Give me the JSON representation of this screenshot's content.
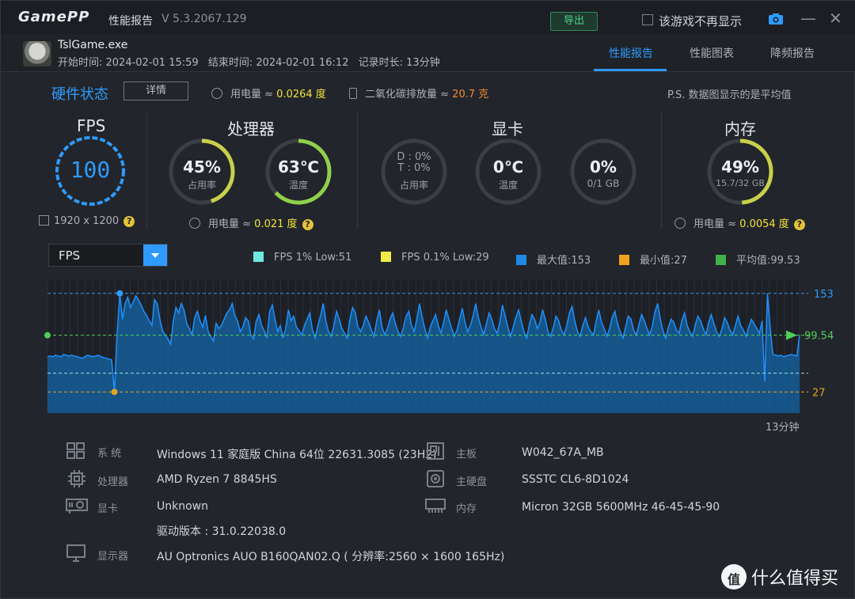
{
  "app": {
    "logo": "GamePP",
    "title": "性能报告",
    "version": "V 5.3.2067.129",
    "export_label": "导出",
    "dont_show_label": "该游戏不再显示"
  },
  "header": {
    "exe": "TslGame.exe",
    "start": "开始时间: 2024-02-01 15:59",
    "end": "结束时间: 2024-02-01 16:12",
    "duration": "记录时长: 13分钟",
    "tabs": [
      {
        "label": "性能报告",
        "active": true
      },
      {
        "label": "性能图表",
        "active": false
      },
      {
        "label": "降频报告",
        "active": false
      }
    ]
  },
  "hardware": {
    "title": "硬件状态",
    "detail_label": "详情",
    "power_prefix": "用电量 ≈ ",
    "power_value": "0.0264 度",
    "co2_prefix": "二氧化碳排放量 ≈ ",
    "co2_value": "20.7 克",
    "ps_note": "P.S. 数据图显示的是平均值"
  },
  "fps_panel": {
    "title": "FPS",
    "value": "100",
    "resolution": "1920 x 1200"
  },
  "cpu_panel": {
    "title": "处理器",
    "usage": {
      "value": "45%",
      "label": "占用率",
      "fraction": 0.45
    },
    "temp": {
      "value": "63℃",
      "label": "温度",
      "fraction": 0.63
    },
    "power_prefix": "用电量 ≈ ",
    "power_value": "0.021 度"
  },
  "gpu_panel": {
    "title": "显卡",
    "usage": {
      "line1": "D : 0%",
      "line2": "T : 0%",
      "label": "占用率",
      "fraction": 0
    },
    "temp": {
      "value": "0℃",
      "label": "温度",
      "fraction": 0
    },
    "vram": {
      "value": "0%",
      "label": "0/1 GB",
      "fraction": 0
    }
  },
  "mem_panel": {
    "title": "内存",
    "usage": {
      "value": "49%",
      "label": "15.7/32 GB",
      "fraction": 0.49
    },
    "power_prefix": "用电量 ≈ ",
    "power_value": "0.0054 度"
  },
  "chart_controls": {
    "selected_metric": "FPS",
    "legend": [
      {
        "label": "FPS 1% Low:51",
        "color": "#6ee7e0"
      },
      {
        "label": "FPS 0.1% Low:29",
        "color": "#f2ea4a"
      },
      {
        "label": "最大值:153",
        "color": "#1e88e5"
      },
      {
        "label": "最小值:27",
        "color": "#f0a21e"
      },
      {
        "label": "平均值:99.53",
        "color": "#3fb24a"
      }
    ],
    "duration_label": "13分钟"
  },
  "chart_data": {
    "type": "area",
    "title": "",
    "xlabel": "",
    "ylabel": "",
    "duration_minutes": 13,
    "y_markers": {
      "max": 153,
      "avg": 99.54,
      "min": 27
    },
    "max_label": "153",
    "avg_label": "99.54",
    "min_label": "27",
    "ylim": [
      0,
      170
    ],
    "series": [
      {
        "values": [
          72,
          73,
          72,
          74,
          73,
          72,
          75,
          74,
          73,
          74,
          73,
          72,
          71,
          70,
          72,
          74,
          73,
          72,
          73,
          74,
          72,
          71,
          70,
          69,
          68,
          27,
          100,
          153,
          120,
          140,
          148,
          135,
          142,
          150,
          145,
          138,
          130,
          125,
          118,
          112,
          145,
          140,
          120,
          105,
          100,
          95,
          88,
          118,
          135,
          128,
          140,
          132,
          115,
          108,
          100,
          122,
          130,
          118,
          110,
          125,
          105,
          98,
          92,
          115,
          108,
          112,
          120,
          128,
          132,
          140,
          125,
          118,
          104,
          110,
          122,
          118,
          100,
          95,
          118,
          126,
          112,
          105,
          96,
          130,
          138,
          120,
          104,
          112,
          96,
          108,
          132,
          118,
          124,
          110,
          105,
          100,
          112,
          120,
          128,
          106,
          96,
          112,
          124,
          140,
          118,
          104,
          98,
          112,
          130,
          120,
          108,
          102,
          96,
          120,
          135,
          128,
          110,
          104,
          112,
          124,
          116,
          106,
          98,
          118,
          132,
          110,
          100,
          108,
          120,
          128,
          114,
          104,
          98,
          110,
          124,
          130,
          112,
          104,
          120,
          140,
          122,
          108,
          96,
          110,
          118,
          126,
          112,
          102,
          116,
          132,
          120,
          108,
          98,
          106,
          120,
          134,
          116,
          104,
          112,
          124,
          140,
          122,
          110,
          100,
          114,
          128,
          120,
          108,
          102,
          116,
          138,
          124,
          110,
          98,
          110,
          122,
          132,
          118,
          104,
          96,
          112,
          126,
          120,
          108,
          116,
          132,
          120,
          104,
          98,
          110,
          124,
          118,
          106,
          100,
          112,
          128,
          136,
          118,
          104,
          98,
          112,
          122,
          110,
          104,
          100,
          118,
          132,
          116,
          108,
          98,
          108,
          122,
          130,
          114,
          104,
          96,
          110,
          124,
          120,
          106,
          100,
          114,
          126,
          118,
          108,
          100,
          112,
          130,
          140,
          120,
          104,
          96,
          110,
          120,
          116,
          106,
          102,
          118,
          128,
          112,
          104,
          98,
          112,
          124,
          118,
          108,
          100,
          116,
          126,
          114,
          104,
          98,
          108,
          122,
          116,
          106,
          100,
          112,
          124,
          112,
          106,
          98,
          110,
          120,
          114,
          108,
          102,
          118,
          40,
          153,
          110,
          75,
          74,
          73,
          74,
          72,
          73,
          74,
          75,
          74,
          73,
          100
        ]
      }
    ]
  },
  "system_info": [
    {
      "key": "系  统",
      "value": "Windows 11 家庭版 China 64位 22631.3085 (23H2)",
      "icon": "windows-icon"
    },
    {
      "key": "处理器",
      "value": "AMD Ryzen 7 8845HS",
      "icon": "cpu-icon"
    },
    {
      "key": "显卡",
      "value": "Unknown",
      "icon": "gpu-icon"
    },
    {
      "key": "",
      "value": "驱动版本 : 31.0.22038.0",
      "icon": ""
    },
    {
      "key": "显示器",
      "value": "AU Optronics AUO B160QAN02.Q ( 分辨率:2560 × 1600 165Hz)",
      "icon": "monitor-icon"
    },
    {
      "key": "主板",
      "value": "W042_67A_MB",
      "icon": "motherboard-icon"
    },
    {
      "key": "主硬盘",
      "value": "SSSTC CL6-8D1024",
      "icon": "disk-icon"
    },
    {
      "key": "内存",
      "value": "Micron 32GB 5600MHz 46-45-45-90",
      "icon": "memory-icon"
    }
  ],
  "watermark": {
    "text": "什么值得买"
  }
}
